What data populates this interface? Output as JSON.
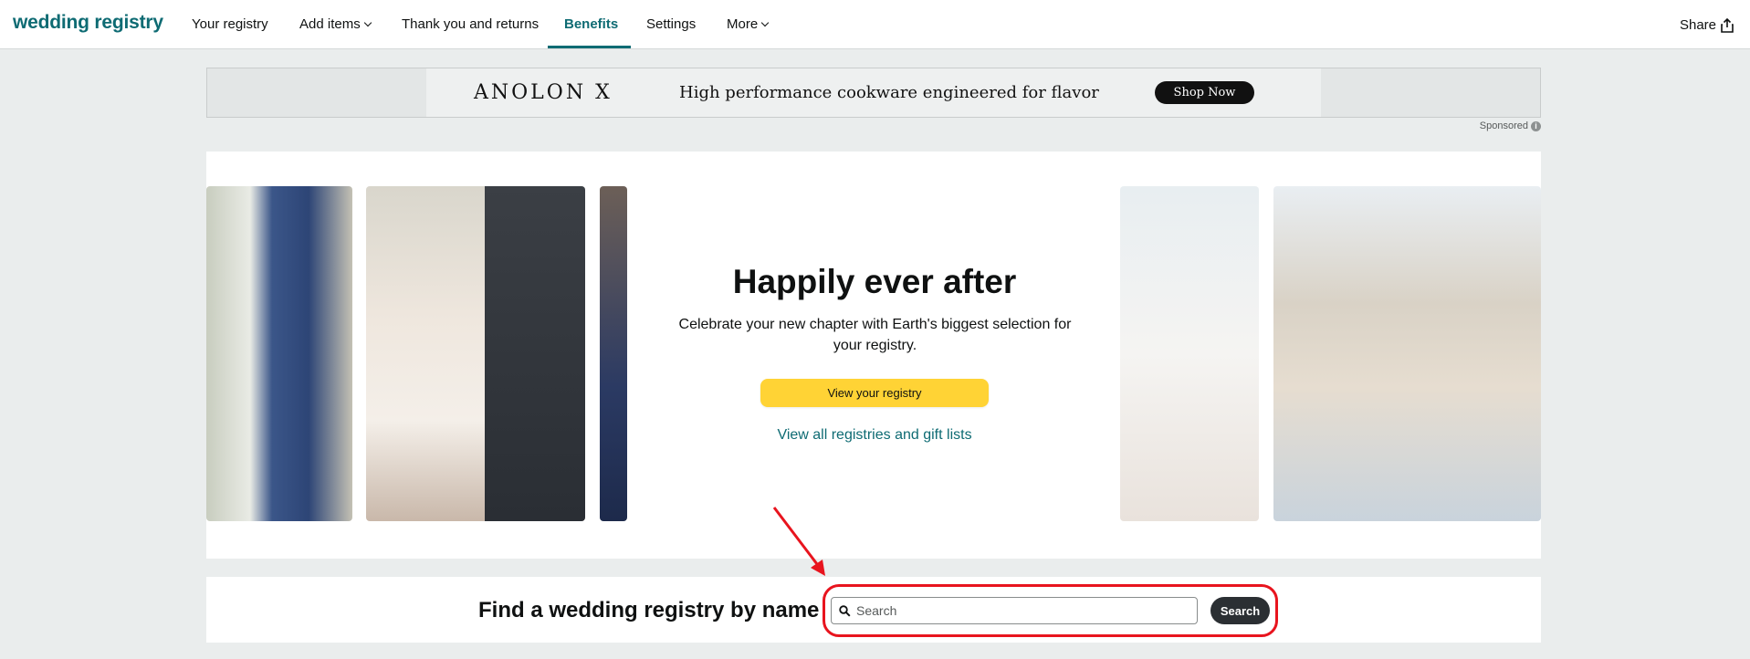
{
  "nav": {
    "brand": "wedding registry",
    "items": [
      {
        "label": "Your registry"
      },
      {
        "label": "Add items"
      },
      {
        "label": "Thank you and returns"
      },
      {
        "label": "Benefits"
      },
      {
        "label": "Settings"
      },
      {
        "label": "More"
      }
    ],
    "active": "Benefits",
    "share_label": "Share"
  },
  "ad": {
    "logo": "ANOLON X",
    "headline": "High performance cookware engineered for flavor",
    "cta": "Shop Now",
    "sponsored": "Sponsored"
  },
  "hero": {
    "title": "Happily ever after",
    "subtitle": "Celebrate your new chapter with Earth's biggest selection for your registry.",
    "button": "View your registry",
    "link": "View all registries and gift lists"
  },
  "find": {
    "label": "Find a wedding registry by name",
    "placeholder": "Search",
    "button": "Search"
  },
  "colors": {
    "accent": "#0e6b73",
    "button_yellow": "#ffd335",
    "highlight_red": "#e8141e"
  }
}
